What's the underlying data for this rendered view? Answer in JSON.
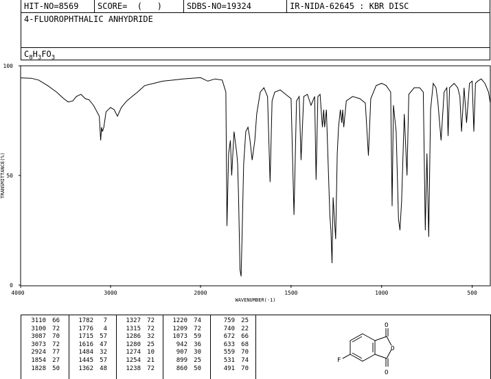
{
  "header": {
    "hit_no": "HIT-NO=8569",
    "score": "SCORE=  (   )",
    "sdbs_no": "SDBS-NO=19324",
    "ir_id": "IR-NIDA-62645 : KBR DISC",
    "compound_name": "4-FLUOROPHTHALIC ANHYDRIDE",
    "formula": {
      "c": "C",
      "c_n": "8",
      "h": "H",
      "h_n": "3",
      "f": "F",
      "o": "O",
      "o_n": "3"
    }
  },
  "chart_data": {
    "type": "line",
    "xlabel": "WAVENUMBER(-1)",
    "ylabel": "TRANSMITTANCE(%)",
    "xlim": [
      4000,
      400
    ],
    "ylim": [
      0,
      100
    ],
    "x_reversed": true,
    "x_ticks": [
      "4000",
      "3000",
      "2000",
      "1500",
      "1000",
      "500"
    ],
    "x_tick_values": [
      4000,
      3000,
      2000,
      1500,
      1000,
      500
    ],
    "y_ticks": [
      "100",
      "50",
      "0"
    ],
    "y_tick_values": [
      100,
      50,
      0
    ],
    "grid": false,
    "baseline": [
      [
        4000,
        94.5
      ],
      [
        3880,
        94.3
      ],
      [
        3800,
        93.5
      ],
      [
        3700,
        91
      ],
      [
        3600,
        88
      ],
      [
        3520,
        85
      ],
      [
        3470,
        83.5
      ],
      [
        3420,
        84
      ],
      [
        3380,
        86
      ],
      [
        3330,
        87
      ],
      [
        3280,
        85
      ],
      [
        3240,
        84.5
      ],
      [
        3190,
        82
      ],
      [
        3150,
        79
      ],
      [
        3125,
        77
      ],
      [
        3110,
        66
      ],
      [
        3100,
        72
      ],
      [
        3090,
        70
      ],
      [
        3075,
        72
      ],
      [
        3050,
        79
      ],
      [
        3000,
        81
      ],
      [
        2960,
        80
      ],
      [
        2924,
        77
      ],
      [
        2880,
        81
      ],
      [
        2820,
        84
      ],
      [
        2760,
        86
      ],
      [
        2700,
        88
      ],
      [
        2620,
        91
      ],
      [
        2520,
        92
      ],
      [
        2420,
        93
      ],
      [
        2300,
        93.5
      ],
      [
        2200,
        94
      ],
      [
        2100,
        94.3
      ],
      [
        2000,
        94.6
      ],
      [
        1960,
        93
      ],
      [
        1920,
        94
      ],
      [
        1880,
        93.5
      ],
      [
        1860,
        88
      ],
      [
        1854,
        27
      ],
      [
        1845,
        60
      ],
      [
        1835,
        66
      ],
      [
        1828,
        50
      ],
      [
        1815,
        70
      ],
      [
        1800,
        60
      ],
      [
        1795,
        55
      ],
      [
        1790,
        40
      ],
      [
        1782,
        7
      ],
      [
        1776,
        4
      ],
      [
        1770,
        25
      ],
      [
        1762,
        55
      ],
      [
        1750,
        70
      ],
      [
        1738,
        72
      ],
      [
        1728,
        67
      ],
      [
        1715,
        57
      ],
      [
        1700,
        66
      ],
      [
        1690,
        78
      ],
      [
        1670,
        88
      ],
      [
        1650,
        90
      ],
      [
        1630,
        86
      ],
      [
        1616,
        47
      ],
      [
        1605,
        84
      ],
      [
        1590,
        88
      ],
      [
        1560,
        89
      ],
      [
        1530,
        87
      ],
      [
        1500,
        85
      ],
      [
        1484,
        32
      ],
      [
        1470,
        84
      ],
      [
        1455,
        86
      ],
      [
        1445,
        57
      ],
      [
        1430,
        86
      ],
      [
        1410,
        87
      ],
      [
        1390,
        82
      ],
      [
        1370,
        86
      ],
      [
        1362,
        48
      ],
      [
        1352,
        86
      ],
      [
        1340,
        87
      ],
      [
        1327,
        72
      ],
      [
        1320,
        80
      ],
      [
        1315,
        72
      ],
      [
        1305,
        80
      ],
      [
        1286,
        32
      ],
      [
        1280,
        25
      ],
      [
        1274,
        10
      ],
      [
        1268,
        40
      ],
      [
        1254,
        21
      ],
      [
        1245,
        60
      ],
      [
        1238,
        72
      ],
      [
        1228,
        80
      ],
      [
        1220,
        74
      ],
      [
        1215,
        80
      ],
      [
        1209,
        72
      ],
      [
        1195,
        84
      ],
      [
        1160,
        86
      ],
      [
        1120,
        85
      ],
      [
        1090,
        83
      ],
      [
        1073,
        59
      ],
      [
        1060,
        85
      ],
      [
        1030,
        91
      ],
      [
        1000,
        92
      ],
      [
        975,
        91
      ],
      [
        950,
        88
      ],
      [
        942,
        36
      ],
      [
        935,
        82
      ],
      [
        920,
        70
      ],
      [
        907,
        30
      ],
      [
        900,
        26
      ],
      [
        899,
        25
      ],
      [
        890,
        38
      ],
      [
        875,
        78
      ],
      [
        860,
        50
      ],
      [
        850,
        87
      ],
      [
        820,
        90
      ],
      [
        790,
        90
      ],
      [
        770,
        88
      ],
      [
        759,
        25
      ],
      [
        750,
        60
      ],
      [
        740,
        22
      ],
      [
        730,
        80
      ],
      [
        715,
        92
      ],
      [
        700,
        90
      ],
      [
        690,
        84
      ],
      [
        672,
        66
      ],
      [
        655,
        88
      ],
      [
        640,
        90
      ],
      [
        633,
        68
      ],
      [
        625,
        90
      ],
      [
        600,
        92
      ],
      [
        580,
        90
      ],
      [
        568,
        86
      ],
      [
        559,
        70
      ],
      [
        545,
        90
      ],
      [
        531,
        74
      ],
      [
        515,
        92
      ],
      [
        500,
        93
      ],
      [
        491,
        70
      ],
      [
        482,
        92
      ],
      [
        470,
        93
      ],
      [
        450,
        94
      ],
      [
        430,
        92
      ],
      [
        410,
        88
      ],
      [
        400,
        83
      ]
    ]
  },
  "peak_table": {
    "columns": [
      [
        [
          "3110",
          "66"
        ],
        [
          "3100",
          "72"
        ],
        [
          "3087",
          "70"
        ],
        [
          "3073",
          "72"
        ],
        [
          "2924",
          "77"
        ],
        [
          "1854",
          "27"
        ],
        [
          "1828",
          "50"
        ]
      ],
      [
        [
          "1782",
          "7"
        ],
        [
          "1776",
          "4"
        ],
        [
          "1715",
          "57"
        ],
        [
          "1616",
          "47"
        ],
        [
          "1484",
          "32"
        ],
        [
          "1445",
          "57"
        ],
        [
          "1362",
          "48"
        ]
      ],
      [
        [
          "1327",
          "72"
        ],
        [
          "1315",
          "72"
        ],
        [
          "1286",
          "32"
        ],
        [
          "1280",
          "25"
        ],
        [
          "1274",
          "10"
        ],
        [
          "1254",
          "21"
        ],
        [
          "1238",
          "72"
        ]
      ],
      [
        [
          "1220",
          "74"
        ],
        [
          "1209",
          "72"
        ],
        [
          "1073",
          "59"
        ],
        [
          "942",
          "36"
        ],
        [
          "907",
          "30"
        ],
        [
          "899",
          "25"
        ],
        [
          "860",
          "50"
        ]
      ],
      [
        [
          "759",
          "25"
        ],
        [
          "740",
          "22"
        ],
        [
          "672",
          "66"
        ],
        [
          "633",
          "68"
        ],
        [
          "559",
          "70"
        ],
        [
          "531",
          "74"
        ],
        [
          "491",
          "70"
        ]
      ]
    ]
  },
  "structure": {
    "atom_labels": {
      "o_top": "O",
      "o_ring": "O",
      "o_bottom": "O",
      "f": "F"
    }
  }
}
